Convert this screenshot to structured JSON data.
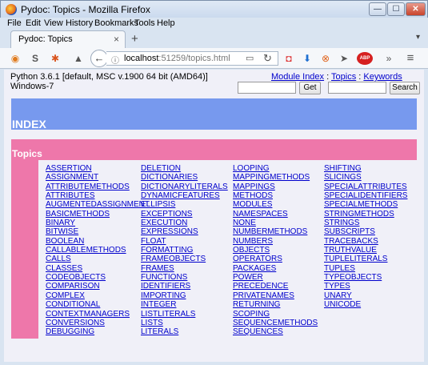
{
  "window": {
    "title": "Pydoc: Topics - Mozilla Firefox",
    "min_glyph": "—",
    "max_glyph": "☐",
    "close_glyph": "✕"
  },
  "menubar": [
    "File",
    "Edit",
    "View",
    "History",
    "Bookmarks",
    "Tools",
    "Help"
  ],
  "tab": {
    "label": "Pydoc: Topics",
    "close_glyph": "×",
    "new_tab_glyph": "+",
    "menu_glyph": "▾"
  },
  "navbar": {
    "url_host": "localhost",
    "url_rest": ":51259/topics.html",
    "back_glyph": "←",
    "reload_glyph": "↻",
    "reader_glyph": "▭",
    "info_glyph": "ⓘ",
    "icons": [
      "rss-icon",
      "s-icon",
      "extension-icon",
      "library-icon",
      "pocket-icon",
      "download-icon",
      "addon-icon",
      "send-icon",
      "abp-icon",
      "overflow-icon",
      "menu-icon"
    ],
    "glyphs": {
      "rss": "◉",
      "s": "S",
      "ext": "✱",
      "lib": "▲",
      "pocket": "◘",
      "download": "⬇",
      "addon": "⊗",
      "send": "➤",
      "abp": "ABP",
      "overflow": "»",
      "menu": "≡"
    }
  },
  "page": {
    "python_version": "Python 3.6.1 [default, MSC v.1900 64 bit (AMD64)]",
    "os": "Windows-7",
    "links": {
      "module_index": "Module Index",
      "topics": "Topics",
      "keywords": "Keywords",
      "sep": ":"
    },
    "get_button": "Get",
    "search_button": "Search",
    "get_value": "",
    "search_value": "",
    "index_title": "INDEX",
    "topics_title": "Topics",
    "topics": {
      "col1": [
        "ASSERTION",
        "ASSIGNMENT",
        "ATTRIBUTEMETHODS",
        "ATTRIBUTES",
        "AUGMENTEDASSIGNMENT",
        "BASICMETHODS",
        "BINARY",
        "BITWISE",
        "BOOLEAN",
        "CALLABLEMETHODS",
        "CALLS",
        "CLASSES",
        "CODEOBJECTS",
        "COMPARISON",
        "COMPLEX",
        "CONDITIONAL",
        "CONTEXTMANAGERS",
        "CONVERSIONS",
        "DEBUGGING"
      ],
      "col2": [
        "DELETION",
        "DICTIONARIES",
        "DICTIONARYLITERALS",
        "DYNAMICFEATURES",
        "ELLIPSIS",
        "EXCEPTIONS",
        "EXECUTION",
        "EXPRESSIONS",
        "FLOAT",
        "FORMATTING",
        "FRAMEOBJECTS",
        "FRAMES",
        "FUNCTIONS",
        "IDENTIFIERS",
        "IMPORTING",
        "INTEGER",
        "LISTLITERALS",
        "LISTS",
        "LITERALS"
      ],
      "col3": [
        "LOOPING",
        "MAPPINGMETHODS",
        "MAPPINGS",
        "METHODS",
        "MODULES",
        "NAMESPACES",
        "NONE",
        "NUMBERMETHODS",
        "NUMBERS",
        "OBJECTS",
        "OPERATORS",
        "PACKAGES",
        "POWER",
        "PRECEDENCE",
        "PRIVATENAMES",
        "RETURNING",
        "SCOPING",
        "SEQUENCEMETHODS",
        "SEQUENCES"
      ],
      "col4": [
        "SHIFTING",
        "SLICINGS",
        "SPECIALATTRIBUTES",
        "SPECIALIDENTIFIERS",
        "SPECIALMETHODS",
        "STRINGMETHODS",
        "STRINGS",
        "SUBSCRIPTS",
        "TRACEBACKS",
        "TRUTHVALUE",
        "TUPLELITERALS",
        "TUPLES",
        "TYPEOBJECTS",
        "TYPES",
        "UNARY",
        "UNICODE"
      ]
    }
  },
  "colors": {
    "index_band": "#7799ee",
    "topics_band": "#ee77aa",
    "link": "#0000cc",
    "page_bg": "#f0f0f8"
  }
}
